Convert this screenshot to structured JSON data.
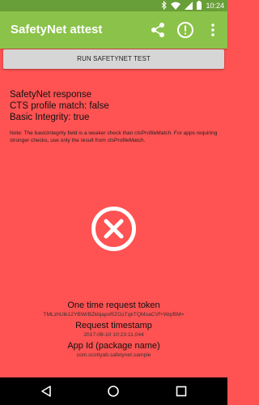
{
  "status_bar": {
    "time": "10:24"
  },
  "app_bar": {
    "title": "SafetyNet attest"
  },
  "run_button": {
    "label": "RUN SAFETYNET TEST"
  },
  "result": {
    "heading": "SafetyNet response",
    "cts_profile_match": "CTS profile match: false",
    "basic_integrity": "Basic Integrity: true",
    "note": "Note: The basicIntegrity field is a weaker check than ctsProfileMatch. For apps requiring stronger checks, use only the result from ctsProfileMatch."
  },
  "status_icon": "error-x-circle-icon",
  "info": {
    "token_label": "One time request token",
    "token_value": "TMLzhUik12YBWrBZkbjapxRZGsTqkTQMsaCVf+Wq/BM=",
    "timestamp_label": "Request timestamp",
    "timestamp_value": "2017-08-10 10:23:11.044",
    "app_id_label": "App Id (package name)",
    "app_id_value": "com.scottyab.safetynet.sample"
  },
  "colors": {
    "status_bar": "#689f38",
    "app_bar": "#8bc34a",
    "failure_background": "#ff5252"
  }
}
